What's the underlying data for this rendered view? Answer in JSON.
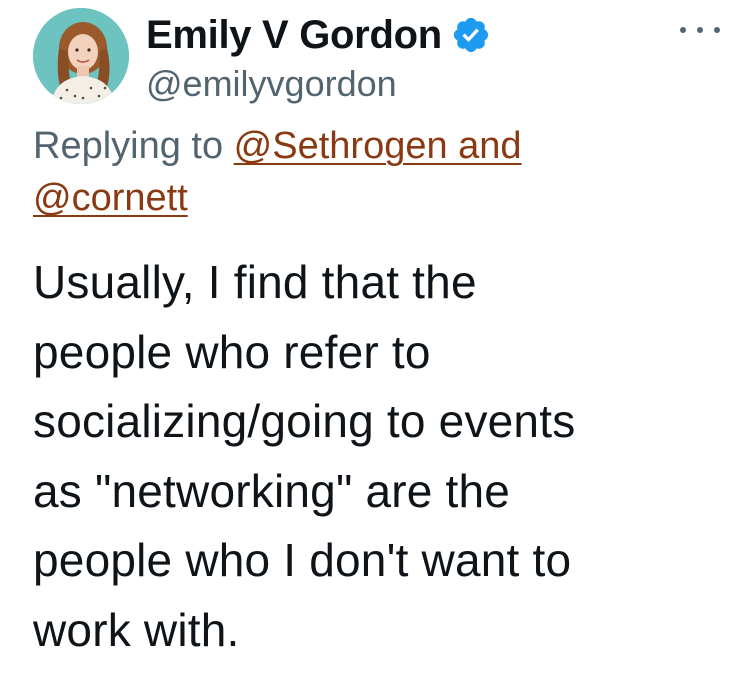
{
  "author": {
    "display_name": "Emily V Gordon",
    "handle": "@emilyvgordon",
    "verified": true,
    "avatar_icon": "profile-photo",
    "verified_icon": "verified-badge-icon",
    "verified_color": "#1d9bf0"
  },
  "header": {
    "more_icon": "more-options-icon"
  },
  "reply": {
    "prefix": "Replying to ",
    "mention_1": "@Sethrogen and",
    "mention_2": "@cornett",
    "mention_color": "#8a3a12"
  },
  "tweet": {
    "lines": [
      "Usually, I find that the",
      "people who refer to",
      "socializing/going to events",
      "as \"networking\" are the",
      "people who I don't want to",
      "work with."
    ]
  }
}
